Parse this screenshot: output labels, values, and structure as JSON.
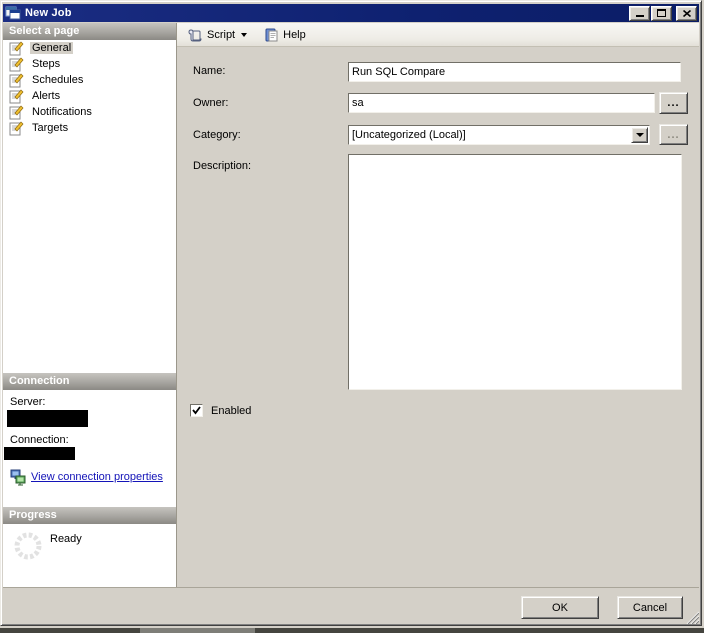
{
  "window": {
    "title": "New Job"
  },
  "sidebar": {
    "select_page_header": "Select a page",
    "pages": [
      {
        "label": "General",
        "selected": true
      },
      {
        "label": "Steps",
        "selected": false
      },
      {
        "label": "Schedules",
        "selected": false
      },
      {
        "label": "Alerts",
        "selected": false
      },
      {
        "label": "Notifications",
        "selected": false
      },
      {
        "label": "Targets",
        "selected": false
      }
    ],
    "connection": {
      "header": "Connection",
      "server_label": "Server:",
      "server_value_redacted": true,
      "connection_label": "Connection:",
      "connection_value_redacted": true,
      "view_link": "View connection properties"
    },
    "progress": {
      "header": "Progress",
      "status": "Ready"
    }
  },
  "toolbar": {
    "script_label": "Script",
    "help_label": "Help"
  },
  "form": {
    "name_label": "Name:",
    "name_value": "Run SQL Compare",
    "owner_label": "Owner:",
    "owner_value": "sa",
    "owner_browse_label": "...",
    "category_label": "Category:",
    "category_value": "[Uncategorized (Local)]",
    "category_browse_label": "...",
    "description_label": "Description:",
    "description_value": "",
    "enabled_label": "Enabled",
    "enabled_checked": true
  },
  "footer": {
    "ok_label": "OK",
    "cancel_label": "Cancel"
  },
  "colors": {
    "titlebar_blue": "#0e2170",
    "link_blue": "#1414b8",
    "selection_gray": "#d4d0c8"
  }
}
